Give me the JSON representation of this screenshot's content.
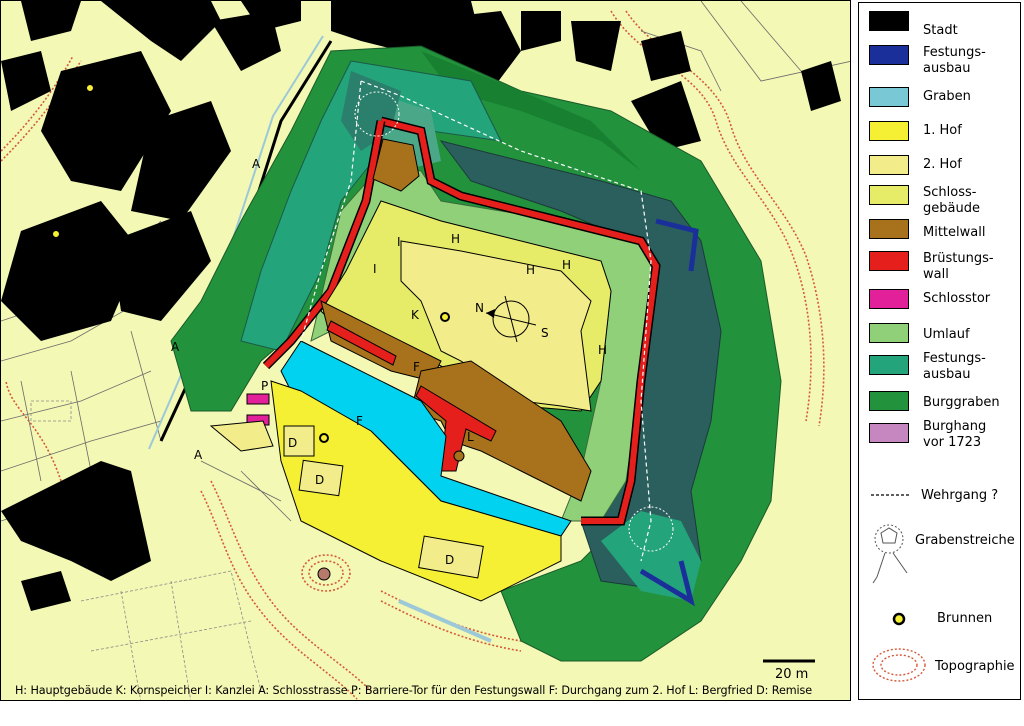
{
  "map": {
    "labels": {
      "H1": "H",
      "H2": "H",
      "H3": "H",
      "H4": "H",
      "I1": "I",
      "I2": "I",
      "K": "K",
      "A1": "A",
      "A2": "A",
      "A3": "A",
      "P": "P",
      "F1": "F",
      "F2": "F",
      "L": "L",
      "D1": "D",
      "D2": "D",
      "D3": "D",
      "N": "N",
      "S": "S"
    },
    "scale_bar": "20 m",
    "caption": "H: Hauptgebäude K: Kornspeicher I: Kanzlei A: Schlosstrasse P: Barriere-Tor für den Festungswall F: Durchgang zum 2. Hof L: Bergfried D: Remise"
  },
  "legend": {
    "items": [
      {
        "label": "Stadt",
        "color": "#000000"
      },
      {
        "label": "Festungs-\nausbau",
        "color": "#1a2f9a"
      },
      {
        "label": "Graben",
        "color": "#78c8d6"
      },
      {
        "label": "1. Hof",
        "color": "#f5f034"
      },
      {
        "label": "2. Hof",
        "color": "#f2ec8a"
      },
      {
        "label": "Schloss-\ngebäude",
        "color": "#e6ec68"
      },
      {
        "label": "Mittelwall",
        "color": "#a8721c"
      },
      {
        "label": "Brüstungs-\nwall",
        "color": "#e5201c"
      },
      {
        "label": "Schlosstor",
        "color": "#e2209a"
      },
      {
        "label": "Umlauf",
        "color": "#90d078"
      },
      {
        "label": "Festungs-\nausbau",
        "color": "#24a47a"
      },
      {
        "label": "Burggraben",
        "color": "#23923c"
      },
      {
        "label": "Burghang\nvor 1723",
        "color": "#c687c1"
      }
    ],
    "wehrgang": "Wehrgang ?",
    "grabenstreiche": "Grabenstreiche",
    "brunnen": "Brunnen",
    "topographie": "Topographie"
  }
}
